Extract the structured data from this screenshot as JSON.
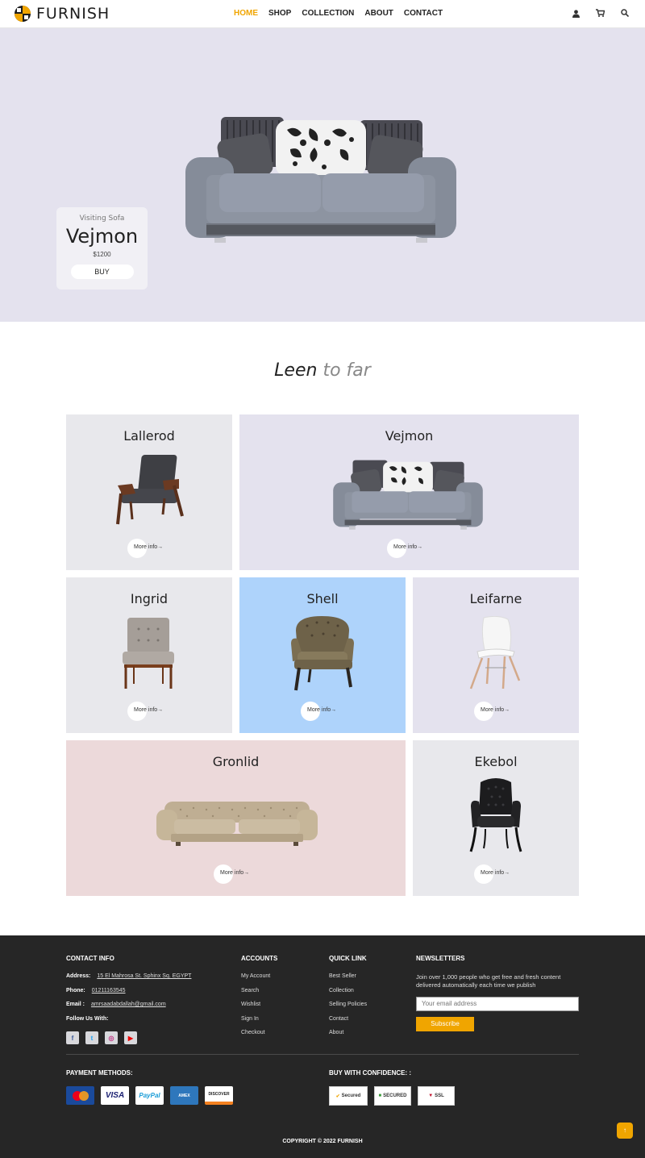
{
  "brand": {
    "name": "FURNISH",
    "accent": "#f0a500"
  },
  "nav": [
    {
      "label": "HOME",
      "active": true
    },
    {
      "label": "SHOP"
    },
    {
      "label": "COLLECTION"
    },
    {
      "label": "ABOUT"
    },
    {
      "label": "CONTACT"
    }
  ],
  "header_icons": [
    "user-icon",
    "cart-icon",
    "search-icon"
  ],
  "hero": {
    "subtitle": "Visiting Sofa",
    "title": "Vejmon",
    "price": "$1200",
    "buy_label": "BUY",
    "background": "#e4e2ee"
  },
  "section": {
    "title_a": "Leen",
    "title_b": "to far"
  },
  "more_label": "More info→",
  "products": [
    {
      "name": "Lallerod",
      "bg": "#e8e8ec"
    },
    {
      "name": "Vejmon",
      "bg": "#e4e2ee"
    },
    {
      "name": "Ingrid",
      "bg": "#e8e8ec"
    },
    {
      "name": "Shell",
      "bg": "#aed3fb"
    },
    {
      "name": "Leifarne",
      "bg": "#e4e2ee"
    },
    {
      "name": "Gronlid",
      "bg": "#ecd9da"
    },
    {
      "name": "Ekebol",
      "bg": "#e8e8ec"
    }
  ],
  "footer": {
    "contact": {
      "heading": "CONTACT INFO",
      "address_label": "Address:",
      "address": "15 El Mahrosa St. Sphinx Sq. EGYPT",
      "phone_label": "Phone:",
      "phone": "01211163545",
      "email_label": "Email :",
      "email": "amrsaadabdallah@gmail.com",
      "follow_label": "Follow Us With:"
    },
    "accounts": {
      "heading": "ACCOUNTS",
      "items": [
        "My Account",
        "Search",
        "Wishlist",
        "Sign In",
        "Checkout"
      ]
    },
    "quick": {
      "heading": "QUICK LINK",
      "items": [
        "Best Seller",
        "Collection",
        "Selling Policies",
        "Contact",
        "About"
      ]
    },
    "news": {
      "heading": "NEWSLETTERS",
      "text": "Join over 1,000 people who get free and fresh content delivered automatically each time we publish",
      "placeholder": "Your email address",
      "button": "Subscribe"
    },
    "payment_heading": "PAYMENT METHODS:",
    "confidence_heading": "BUY WITH CONFIDENCE: :",
    "copyright": "COPYRIGHT © 2022 FURNISH",
    "to_top": "↑"
  }
}
